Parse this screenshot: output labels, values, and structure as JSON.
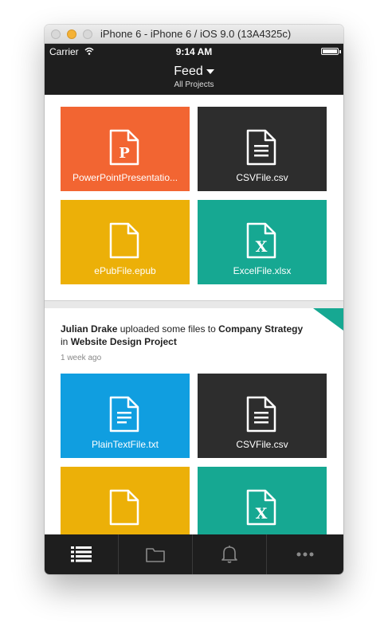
{
  "window": {
    "title": "iPhone 6 - iPhone 6 / iOS 9.0 (13A4325c)"
  },
  "statusbar": {
    "carrier": "Carrier",
    "time": "9:14 AM"
  },
  "navbar": {
    "title": "Feed",
    "subtitle": "All Projects"
  },
  "feed": {
    "card1": {
      "files": [
        {
          "name": "PowerPointPresentatio...",
          "icon": "powerpoint-file-icon",
          "color": "#f26532"
        },
        {
          "name": "CSVFile.csv",
          "icon": "csv-file-icon",
          "color": "#2d2d2d"
        },
        {
          "name": "ePubFile.epub",
          "icon": "epub-file-icon",
          "color": "#ecb008"
        },
        {
          "name": "ExcelFile.xlsx",
          "icon": "excel-file-icon",
          "color": "#16a892"
        }
      ]
    },
    "card2": {
      "activity": {
        "user": "Julian Drake",
        "action": " uploaded some files to ",
        "project_folder": "Company Strategy",
        "in_text": " in ",
        "project": "Website Design Project"
      },
      "time_ago": "1 week ago",
      "files": [
        {
          "name": "PlainTextFile.txt",
          "icon": "text-file-icon",
          "color": "#109ee0"
        },
        {
          "name": "CSVFile.csv",
          "icon": "csv-file-icon",
          "color": "#2d2d2d"
        },
        {
          "name": "",
          "icon": "blank-file-icon",
          "color": "#ecb008"
        },
        {
          "name": "",
          "icon": "excel-file-icon",
          "color": "#16a892"
        }
      ]
    }
  },
  "tabbar": {
    "tabs": [
      {
        "icon": "list-icon",
        "active": true
      },
      {
        "icon": "folder-icon",
        "active": false
      },
      {
        "icon": "bell-icon",
        "active": false
      },
      {
        "icon": "more-icon",
        "active": false
      }
    ]
  }
}
